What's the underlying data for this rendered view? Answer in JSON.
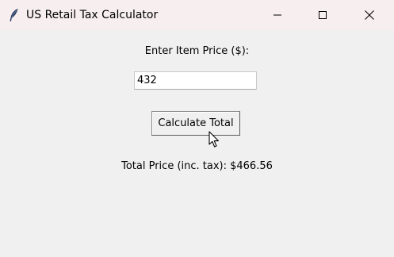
{
  "window": {
    "title": "US Retail Tax Calculator",
    "icon": "feather-icon",
    "controls": {
      "minimize_icon": "minimize-icon",
      "maximize_icon": "maximize-icon",
      "close_icon": "close-icon"
    }
  },
  "form": {
    "price_label": "Enter Item Price ($):",
    "price_value": "432",
    "button_label": "Calculate Total",
    "result_text": "Total Price (inc. tax): $466.56"
  },
  "colors": {
    "titlebar_bg": "#f7efef",
    "window_bg": "#f0f0f0",
    "input_bg": "#ffffff"
  }
}
